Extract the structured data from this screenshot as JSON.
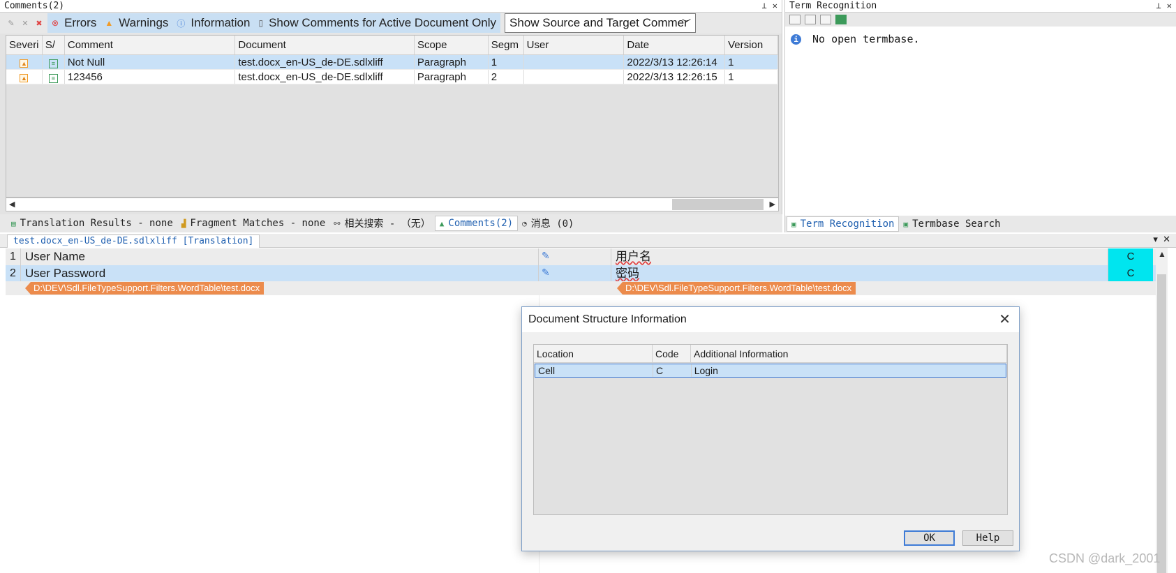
{
  "comments_panel": {
    "title": "Comments(2)",
    "filters": {
      "errors": "Errors",
      "warnings": "Warnings",
      "information": "Information",
      "active_only": "Show Comments for Active Document Only",
      "select_value": "Show Source and Target Commer"
    },
    "columns": [
      "Severi",
      "S/",
      "Comment",
      "Document",
      "Scope",
      "Segm",
      "User",
      "Date",
      "Version"
    ],
    "rows": [
      {
        "comment": "Not Null",
        "document": "test.docx_en-US_de-DE.sdlxliff",
        "scope": "Paragraph",
        "segment": "1",
        "user": "",
        "date": "2022/3/13 12:26:14",
        "version": "1"
      },
      {
        "comment": "123456",
        "document": "test.docx_en-US_de-DE.sdlxliff",
        "scope": "Paragraph",
        "segment": "2",
        "user": "",
        "date": "2022/3/13 12:26:15",
        "version": "1"
      }
    ]
  },
  "bottom_tabs": {
    "translation_results": "Translation Results - none",
    "fragment_matches": "Fragment Matches - none",
    "related_search": "相关搜索 - （无）",
    "comments": "Comments(2)",
    "messages": "消息 (0)"
  },
  "term_panel": {
    "title": "Term Recognition",
    "message": "No open termbase.",
    "tab_recognition": "Term Recognition",
    "tab_search": "Termbase Search"
  },
  "editor": {
    "doc_tab": "test.docx_en-US_de-DE.sdlxliff [Translation]",
    "segments": [
      {
        "num": "1",
        "source": "User Name",
        "target": "用户名",
        "code": "C"
      },
      {
        "num": "2",
        "source": "User Password",
        "target": "密码",
        "code": "C"
      }
    ],
    "source_tag": "D:\\DEV\\Sdl.FileTypeSupport.Filters.WordTable\\test.docx",
    "target_tag": "D:\\DEV\\Sdl.FileTypeSupport.Filters.WordTable\\test.docx"
  },
  "dialog": {
    "title": "Document Structure Information",
    "columns": [
      "Location",
      "Code",
      "Additional Information"
    ],
    "row": {
      "location": "Cell",
      "code": "C",
      "info": "Login"
    },
    "ok": "OK",
    "help": "Help"
  },
  "watermark": "CSDN @dark_2001"
}
